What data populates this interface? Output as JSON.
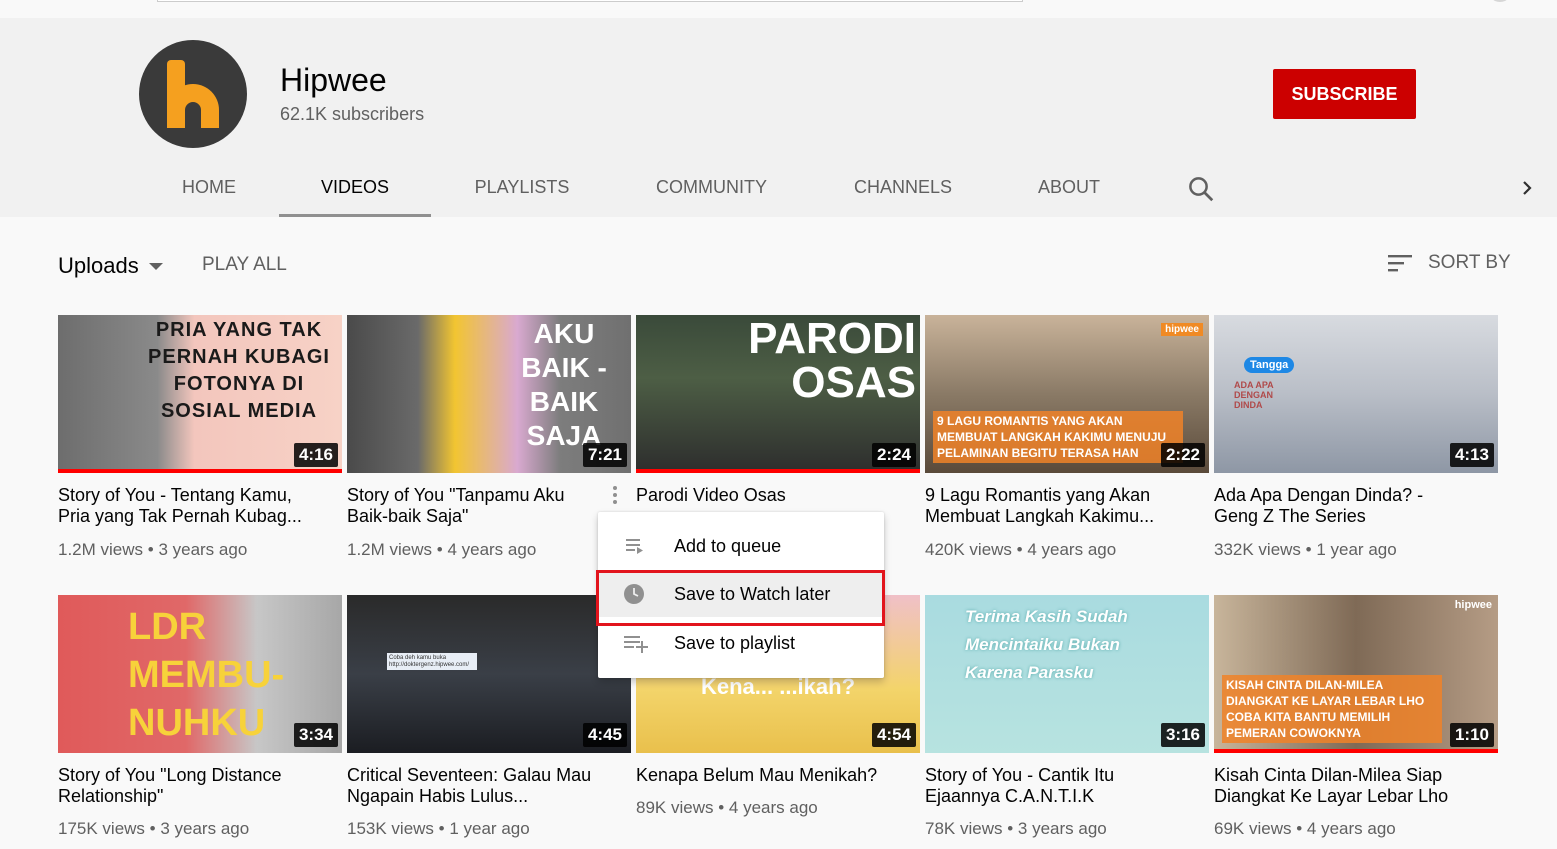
{
  "channel": {
    "name": "Hipwee",
    "subscribers": "62.1K subscribers",
    "subscribe_label": "SUBSCRIBE",
    "avatar_icon": "hipwee-logo-icon"
  },
  "tabs": [
    {
      "label": "HOME"
    },
    {
      "label": "VIDEOS",
      "active": true
    },
    {
      "label": "PLAYLISTS"
    },
    {
      "label": "COMMUNITY"
    },
    {
      "label": "CHANNELS"
    },
    {
      "label": "ABOUT"
    }
  ],
  "toolbar": {
    "uploads_label": "Uploads",
    "play_all_label": "PLAY ALL",
    "sort_by_label": "SORT BY"
  },
  "videos": [
    {
      "title": "Story of You - Tentang Kamu, Pria yang Tak Pernah Kubag...",
      "views": "1.2M views",
      "age": "3 years ago",
      "duration": "4:16",
      "thumb_text": "PRIA YANG TAK PERNAH KUBAGI FOTONYA DI SOSIAL MEDIA",
      "watched_fraction": 1.0
    },
    {
      "title": "Story of You \"Tanpamu Aku Baik-baik Saja\"",
      "views": "1.2M views",
      "age": "4 years ago",
      "duration": "7:21",
      "thumb_text": "AKU BAIK -BAIK SAJA"
    },
    {
      "title": "Parodi Video Osas",
      "views": "",
      "age": "",
      "duration": "2:24",
      "thumb_text": "PARODI OSAS",
      "watched_fraction": 1.0
    },
    {
      "title": "9 Lagu Romantis yang Akan Membuat Langkah Kakimu...",
      "views": "420K views",
      "age": "4 years ago",
      "duration": "2:22",
      "thumb_text": "9 LAGU ROMANTIS YANG AKAN MEMBUAT LANGKAH KAKIMU MENUJU PELAMINAN BEGITU TERASA HAN",
      "brand": "hipwee"
    },
    {
      "title": "Ada Apa Dengan Dinda? - Geng Z The Series",
      "views": "332K views",
      "age": "1 year ago",
      "duration": "4:13",
      "thumb_text": "Tangga",
      "sub_thumb_text": "ADA APA DENGAN DINDA"
    },
    {
      "title": "Story of You \"Long Distance Relationship\"",
      "views": "175K views",
      "age": "3 years ago",
      "duration": "3:34",
      "thumb_text": "LDR MEMBU- NUHKU"
    },
    {
      "title": "Critical Seventeen: Galau Mau Ngapain Habis Lulus...",
      "views": "153K views",
      "age": "1 year ago",
      "duration": "4:45",
      "thumb_text": "Coba deh kamu buka http://doktergenz.hipwee.com/"
    },
    {
      "title": "Kenapa Belum Mau Menikah?",
      "views": "89K views",
      "age": "4 years ago",
      "duration": "4:54",
      "thumb_text": "Kena... ...ikah?"
    },
    {
      "title": "Story of You - Cantik Itu Ejaannya C.A.N.T.I.K",
      "views": "78K views",
      "age": "3 years ago",
      "duration": "3:16",
      "thumb_text": "Terima Kasih Sudah Mencintaiku Bukan Karena Parasku"
    },
    {
      "title": "Kisah Cinta Dilan-Milea Siap Diangkat Ke Layar Lebar Lho",
      "views": "69K views",
      "age": "4 years ago",
      "duration": "1:10",
      "thumb_text": "KISAH CINTA DILAN-MILEA DIANGKAT KE LAYAR LEBAR LHO COBA KITA BANTU MEMILIH PEMERAN COWOKNYA",
      "brand": "hipwee",
      "watched_fraction": 1.0
    }
  ],
  "context_menu": {
    "items": [
      {
        "label": "Add to queue",
        "icon": "queue-icon"
      },
      {
        "label": "Save to Watch later",
        "icon": "clock-icon",
        "highlighted": true
      },
      {
        "label": "Save to playlist",
        "icon": "playlist-add-icon"
      }
    ]
  },
  "colors": {
    "subscribe": "#cc0000",
    "progress": "#ff0000",
    "highlight_box": "#e2141c",
    "avatar_bg": "#3a3a3a",
    "avatar_letter": "#f5a01f"
  }
}
